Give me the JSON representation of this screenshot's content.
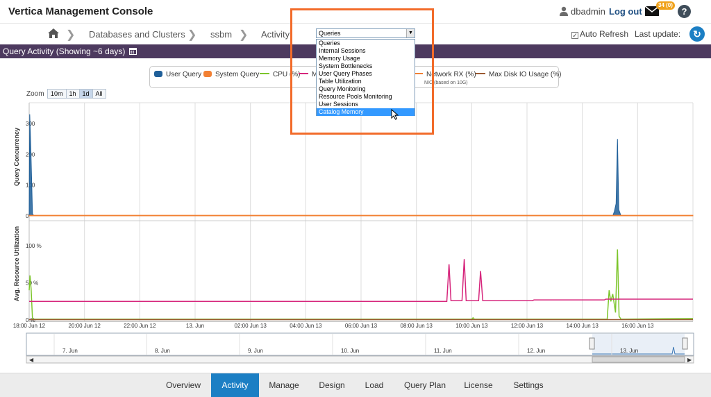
{
  "header": {
    "title": "Vertica Management Console",
    "username": "dbadmin",
    "logout": "Log out",
    "mail_badge": "34 (0)",
    "help": "?"
  },
  "breadcrumb": {
    "items": [
      "Databases and Clusters",
      "ssbm",
      "Activity"
    ]
  },
  "view_select": {
    "selected": "Queries",
    "options": [
      "Queries",
      "Internal Sessions",
      "Memory Usage",
      "System Bottlenecks",
      "User Query Phases",
      "Table Utilization",
      "Query Monitoring",
      "Resource Pools Monitoring",
      "User Sessions",
      "Catalog Memory"
    ],
    "highlighted": "Catalog Memory"
  },
  "toolbar": {
    "auto_refresh": "Auto Refresh",
    "last_update": "Last update:"
  },
  "section": {
    "title": "Query Activity  (Showing ~6 days)"
  },
  "legend": {
    "items": [
      {
        "label": "User Query",
        "color": "#1f5f99",
        "style": "box"
      },
      {
        "label": "System Query",
        "color": "#f28033",
        "style": "box"
      },
      {
        "label": "CPU (%)",
        "color": "#7cc52b",
        "style": "line"
      },
      {
        "label": "M",
        "color": "#d6267c",
        "style": "line"
      },
      {
        "label": "Network RX (%)",
        "color": "#f28033",
        "style": "line"
      },
      {
        "label": "Max Disk IO Usage (%)",
        "color": "#9b5a32",
        "style": "line"
      }
    ],
    "note": "NIC (based on 10G)"
  },
  "zoom": {
    "label": "Zoom",
    "buttons": [
      "10m",
      "1h",
      "1d",
      "All"
    ],
    "active": "1d"
  },
  "chart_data": [
    {
      "type": "area",
      "ylabel": "Query Concurrency",
      "yticks": [
        "0",
        "100",
        "200",
        "300"
      ],
      "ylim": [
        0,
        300
      ],
      "xticks": [
        "18:00 Jun 12",
        "20:00 Jun 12",
        "22:00 Jun 12",
        "13. Jun",
        "02:00 Jun 13",
        "04:00 Jun 13",
        "06:00 Jun 13",
        "08:00 Jun 13",
        "10:00 Jun 13",
        "12:00 Jun 13",
        "14:00 Jun 13",
        "16:00 Jun 13"
      ],
      "series": [
        {
          "name": "User Query",
          "color": "#1f5f99",
          "points": [
            [
              0.0,
              10
            ],
            [
              0.02,
              330
            ],
            [
              0.06,
              220
            ],
            [
              0.12,
              5
            ],
            [
              0.2,
              0
            ],
            [
              21.1,
              0
            ],
            [
              21.16,
              15
            ],
            [
              21.22,
              40
            ],
            [
              21.27,
              250
            ],
            [
              21.32,
              20
            ],
            [
              21.4,
              0
            ],
            [
              24.0,
              0
            ]
          ]
        },
        {
          "name": "System Query",
          "color": "#f28033",
          "points": [
            [
              0.0,
              2
            ],
            [
              24.0,
              2
            ]
          ]
        }
      ]
    },
    {
      "type": "line",
      "ylabel": "Avg. Resource Utilization",
      "yticks": [
        "0 %",
        "50 %",
        "100 %"
      ],
      "ylim": [
        0,
        100
      ],
      "series": [
        {
          "name": "CPU (%)",
          "color": "#7cc52b",
          "points": [
            [
              0.0,
              40
            ],
            [
              0.03,
              60
            ],
            [
              0.07,
              42
            ],
            [
              0.12,
              1
            ],
            [
              16.0,
              1
            ],
            [
              16.05,
              3
            ],
            [
              16.1,
              1
            ],
            [
              20.9,
              1
            ],
            [
              20.97,
              40
            ],
            [
              21.03,
              25
            ],
            [
              21.1,
              35
            ],
            [
              21.2,
              10
            ],
            [
              21.27,
              95
            ],
            [
              21.33,
              5
            ],
            [
              21.4,
              1
            ],
            [
              24.0,
              2
            ]
          ]
        },
        {
          "name": "M",
          "color": "#d6267c",
          "points": [
            [
              0.0,
              25
            ],
            [
              15.1,
              25
            ],
            [
              15.18,
              75
            ],
            [
              15.25,
              26
            ],
            [
              15.65,
              26
            ],
            [
              15.73,
              82
            ],
            [
              15.8,
              26
            ],
            [
              16.25,
              26
            ],
            [
              16.32,
              66
            ],
            [
              16.4,
              26
            ],
            [
              18.2,
              26
            ],
            [
              18.25,
              27
            ],
            [
              20.8,
              27
            ],
            [
              20.85,
              28
            ],
            [
              24.0,
              28
            ]
          ]
        },
        {
          "name": "Max Disk IO Usage (%)",
          "color": "#9b5a32",
          "points": [
            [
              0.0,
              0.5
            ],
            [
              24.0,
              0.5
            ]
          ]
        }
      ]
    }
  ],
  "navigator": {
    "labels": [
      "7. Jun",
      "8. Jun",
      "9. Jun",
      "10. Jun",
      "11. Jun",
      "12. Jun",
      "13. Jun"
    ]
  },
  "bottom_nav": {
    "tabs": [
      "Overview",
      "Activity",
      "Manage",
      "Design",
      "Load",
      "Query Plan",
      "License",
      "Settings"
    ],
    "active": "Activity"
  }
}
